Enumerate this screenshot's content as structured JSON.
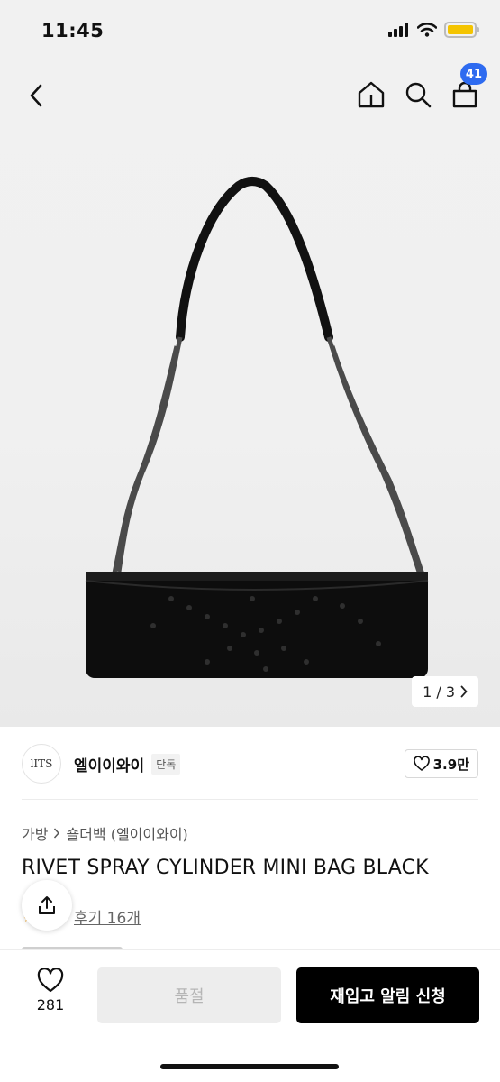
{
  "status_bar": {
    "time": "11:45"
  },
  "nav": {
    "cart_count": "41"
  },
  "gallery": {
    "counter": "1 / 3"
  },
  "brand": {
    "logo_text": "lITS",
    "name": "엘이이와이",
    "tag": "단독",
    "likes": "3.9만"
  },
  "breadcrumb": {
    "category": "가방",
    "subcategory": "숄더백 (엘이이와이)"
  },
  "product": {
    "title": "RIVET SPRAY CYLINDER MINI BAG BLACK",
    "review_link": "후기 16개"
  },
  "bottom_bar": {
    "wish_count": "281",
    "sold_out_label": "품절",
    "restock_label": "재입고 알림 신청"
  },
  "colors": {
    "cart_badge": "#2e6bf0",
    "battery": "#f4c400",
    "primary_button": "#000000"
  }
}
